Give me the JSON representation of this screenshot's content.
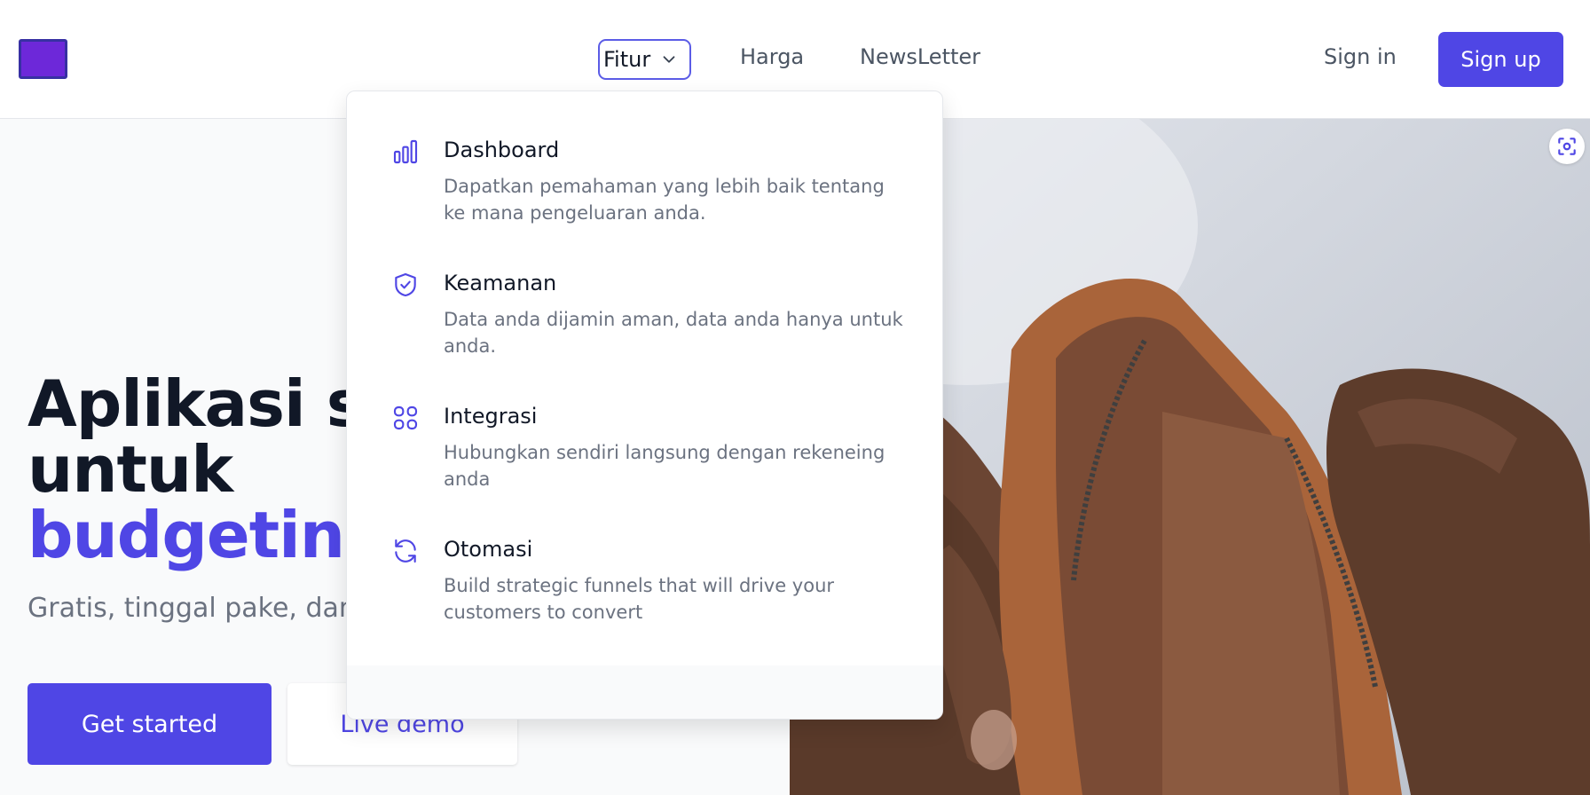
{
  "header": {
    "nav": {
      "fitur": "Fitur",
      "harga": "Harga",
      "newsletter": "NewsLetter"
    },
    "sign_in": "Sign in",
    "sign_up": "Sign up"
  },
  "hero": {
    "title_line1": "Aplikasi se",
    "title_line2": "untuk",
    "title_line3": "budgeting",
    "subtitle": "Gratis, tinggal pake, dan",
    "get_started": "Get started",
    "live_demo": "Live demo"
  },
  "dropdown": {
    "items": [
      {
        "title": "Dashboard",
        "description": "Dapatkan pemahaman yang lebih baik tentang ke mana pengeluaran anda.",
        "icon": "bar-chart-icon"
      },
      {
        "title": "Keamanan",
        "description": "Data anda dijamin aman, data anda hanya untuk anda.",
        "icon": "shield-check-icon"
      },
      {
        "title": "Integrasi",
        "description": "Hubungkan sendiri langsung dengan rekeneing anda",
        "icon": "grid-icon"
      },
      {
        "title": "Otomasi",
        "description": "Build strategic funnels that will drive your customers to convert",
        "icon": "refresh-icon"
      }
    ]
  },
  "colors": {
    "accent": "#4f46e5",
    "logo": "#6d28d9"
  }
}
